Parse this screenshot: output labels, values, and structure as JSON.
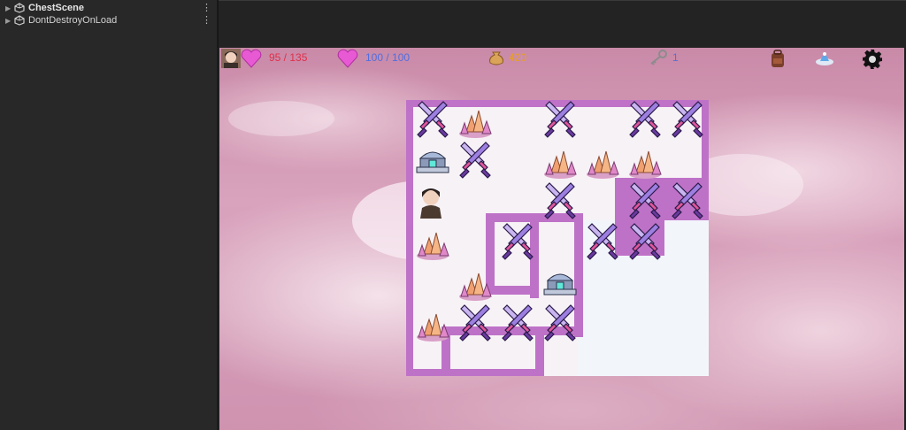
{
  "hierarchy": {
    "items": [
      {
        "label": "ChestScene",
        "bold": true
      },
      {
        "label": "DontDestroyOnLoad",
        "bold": false
      }
    ]
  },
  "hud": {
    "health_text": "95 / 135",
    "energy_text": "100 / 100",
    "gold_text": "420",
    "keys_text": "1",
    "colors": {
      "health": "#e0304a",
      "energy": "#4f6fe0",
      "gold": "#e8a020",
      "keys": "#5a6fd0"
    }
  },
  "board": {
    "rows": [
      [
        "sword",
        "forest",
        "",
        "sword",
        "",
        "sword",
        "sword"
      ],
      [
        "chest",
        "sword",
        "",
        "forest",
        "forest",
        "forest",
        ""
      ],
      [
        "player",
        "",
        "",
        "sword",
        "",
        "sword",
        "sword"
      ],
      [
        "forest",
        "",
        "sword",
        "",
        "sword",
        "sword",
        ""
      ],
      [
        "",
        "forest",
        "",
        "chest",
        "",
        "",
        ""
      ],
      [
        "forest",
        "sword",
        "sword",
        "sword",
        "",
        "",
        ""
      ],
      [
        "",
        "",
        "",
        "",
        "",
        "",
        ""
      ]
    ]
  }
}
